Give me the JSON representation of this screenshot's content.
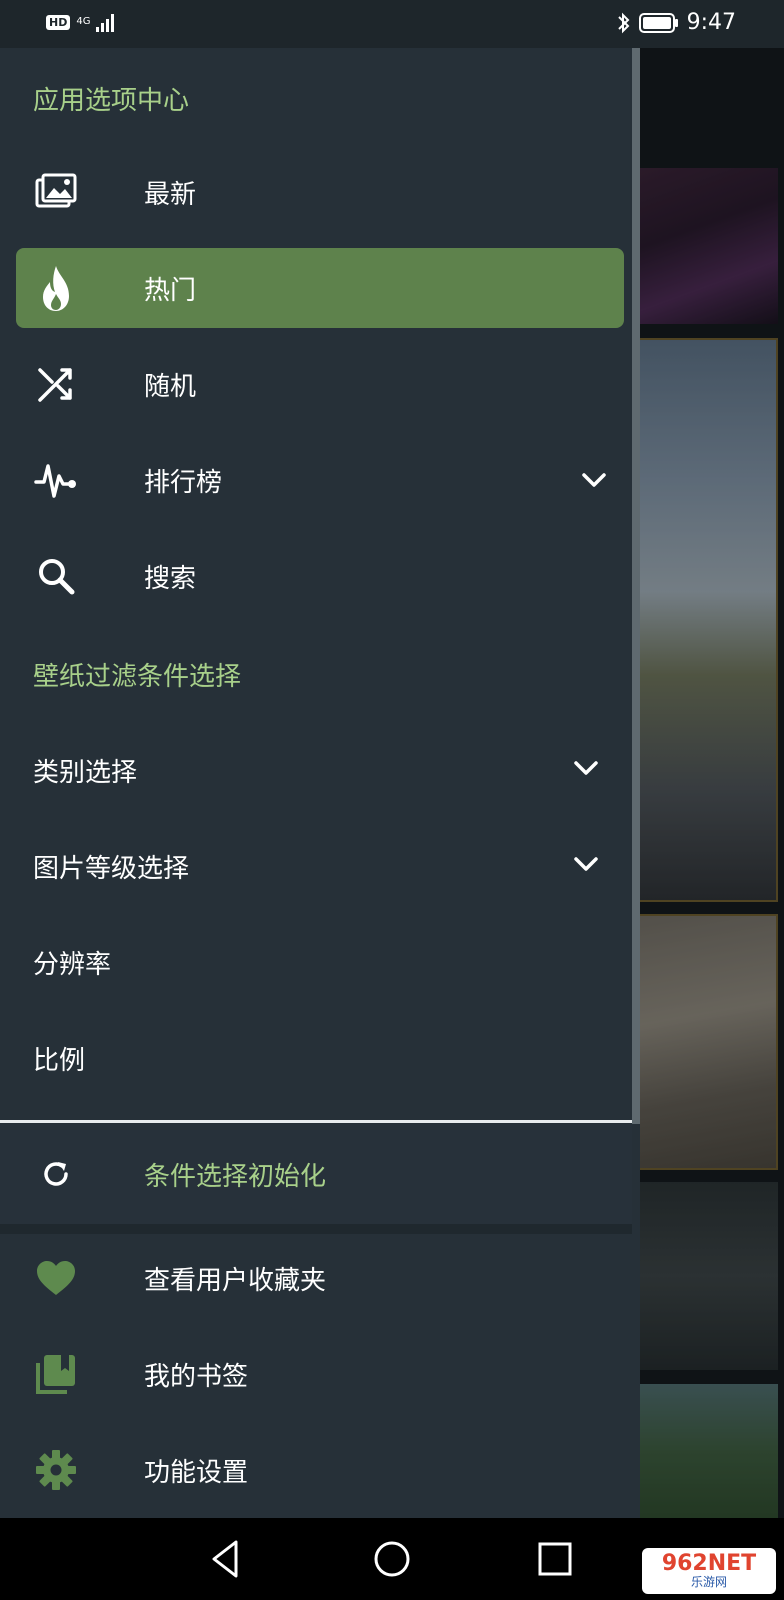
{
  "status_bar": {
    "hd_label": "HD",
    "network_label": "4G",
    "time": "9:47",
    "icons": [
      "hd-icon",
      "signal-icon",
      "bluetooth-icon",
      "battery-icon"
    ]
  },
  "drawer": {
    "section_app": "应用选项中心",
    "menu": [
      {
        "label": "最新",
        "icon": "images-icon"
      },
      {
        "label": "热门",
        "icon": "flame-icon",
        "active": true
      },
      {
        "label": "随机",
        "icon": "shuffle-icon"
      },
      {
        "label": "排行榜",
        "icon": "pulse-icon",
        "expandable": true
      },
      {
        "label": "搜索",
        "icon": "search-icon"
      }
    ],
    "section_filter": "壁纸过滤条件选择",
    "filters": [
      {
        "label": "类别选择",
        "expandable": true
      },
      {
        "label": "图片等级选择",
        "expandable": true
      },
      {
        "label": "分辨率"
      },
      {
        "label": "比例"
      }
    ],
    "reset_label": "条件选择初始化",
    "bottom": [
      {
        "label": "查看用户收藏夹",
        "icon": "heart-icon"
      },
      {
        "label": "我的书签",
        "icon": "bookmarks-icon"
      },
      {
        "label": "功能设置",
        "icon": "gear-icon"
      }
    ]
  },
  "nav_bar": {
    "buttons": [
      "back-icon",
      "home-icon",
      "recents-icon"
    ]
  },
  "watermark": {
    "brand": "962NET",
    "sub": "乐游网"
  },
  "colors": {
    "drawer_bg": "#263038",
    "accent_green": "#a8d08a",
    "active_bg": "#5e824c",
    "icon_green": "#5e8a4e"
  }
}
